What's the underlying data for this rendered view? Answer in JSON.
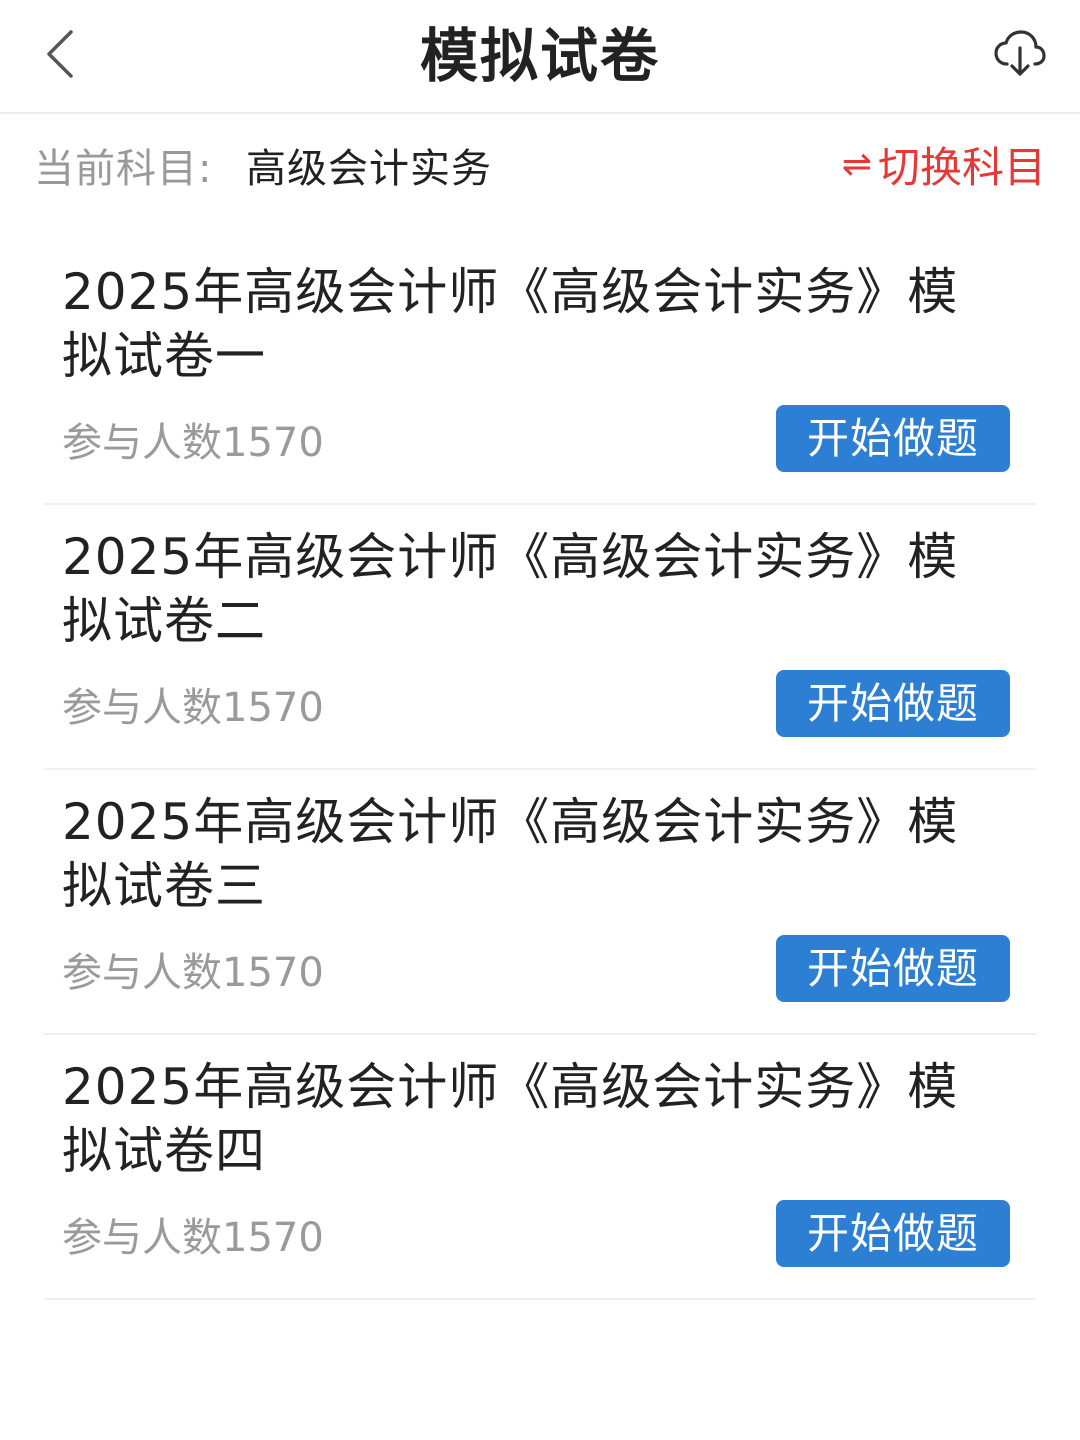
{
  "header": {
    "title": "模拟试卷",
    "back_icon": "chevron-left-icon",
    "download_icon": "cloud-download-icon"
  },
  "subject": {
    "label": "当前科目:",
    "value": "高级会计实务",
    "switch_label": "切换科目",
    "switch_icon": "⇌",
    "switch_color": "#e53935"
  },
  "exams": [
    {
      "title": "2025年高级会计师《高级会计实务》模拟试卷一",
      "participants": "参与人数1570",
      "button_label": "开始做题"
    },
    {
      "title": "2025年高级会计师《高级会计实务》模拟试卷二",
      "participants": "参与人数1570",
      "button_label": "开始做题"
    },
    {
      "title": "2025年高级会计师《高级会计实务》模拟试卷三",
      "participants": "参与人数1570",
      "button_label": "开始做题"
    },
    {
      "title": "2025年高级会计师《高级会计实务》模拟试卷四",
      "participants": "参与人数1570",
      "button_label": "开始做题"
    }
  ],
  "colors": {
    "accent_button": "#2d7fd3",
    "switch_text": "#e53935",
    "muted_text": "#999999"
  }
}
